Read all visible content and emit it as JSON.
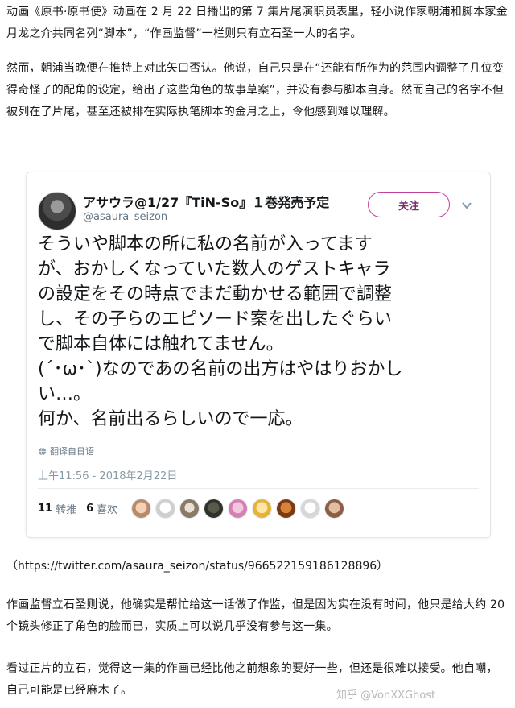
{
  "article": {
    "paragraph1": "动画《原书·原书使》动画在 2 月 22 日播出的第 7 集片尾演职员表里，轻小说作家朝浦和脚本家金月龙之介共同名列“脚本”，“作画监督”一栏则只有立石圣一人的名字。",
    "paragraph2": "然而，朝浦当晚便在推特上对此矢口否认。他说，自己只是在“还能有所作为的范围内调整了几位变得奇怪了的配角的设定，给出了这些角色的故事草案”，并没有参与脚本自身。然而自己的名字不但被列在了片尾，甚至还被排在实际执笔脚本的金月之上，令他感到难以理解。",
    "source_link": "（https://twitter.com/asaura_seizon/status/966522159186128896）",
    "paragraph3": "作画监督立石圣则说，他确实是帮忙给这一话做了作监，但是因为实在没有时间，他只是给大约 20 个镜头修正了角色的脸而已，实质上可以说几乎没有参与这一集。",
    "paragraph4": "看过正片的立石，觉得这一集的作画已经比他之前想象的要好一些，但还是很难以接受。他自嘲，自己可能是已经麻木了。"
  },
  "tweet": {
    "author_name": "アサウラ@1/27『TiN-So』１巻発売予定",
    "author_handle": "@asaura_seizon",
    "follow_label": "关注",
    "text_lines": [
      "そういや脚本の所に私の名前が入ってます",
      "が、おかしくなっていた数人のゲストキャラ",
      "の設定をその時点でまだ動かせる範囲で調整",
      "し、その子らのエピソード案を出したぐらい",
      "で脚本自体には触れてません。",
      "(´･ω･`)なのであの名前の出方はやはりおかし",
      "い…。",
      "何か、名前出るらしいので一応。"
    ],
    "translate_label": "翻译自日语",
    "timestamp": "上午11:56 - 2018年2月22日",
    "retweets_count": "11",
    "retweets_label": "转推",
    "likes_count": "6",
    "likes_label": "喜欢",
    "follow_color": "#c23fa0"
  },
  "watermark": "知乎 @VonXXGhost"
}
